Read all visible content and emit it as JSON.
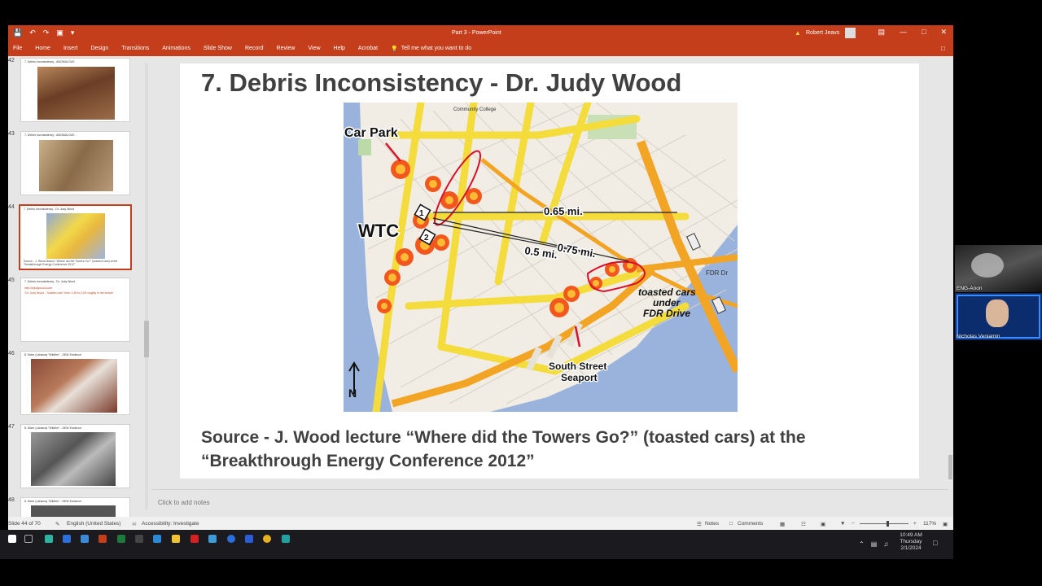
{
  "app": {
    "title": "Part 3  -  PowerPoint",
    "user": "Robert Jeavs",
    "warning_icon": "warning-icon",
    "quick_access": [
      "save-icon",
      "undo-icon",
      "redo-icon",
      "present-icon",
      "more-icon"
    ],
    "window_buttons": [
      "ribbon-display-icon",
      "minimize-icon",
      "maximize-icon",
      "close-icon"
    ]
  },
  "menu": {
    "items": [
      "File",
      "Home",
      "Insert",
      "Design",
      "Transitions",
      "Animations",
      "Slide Show",
      "Record",
      "Review",
      "View",
      "Help",
      "Acrobat"
    ],
    "tell_me": "Tell me what you want to do"
  },
  "sidebar": {
    "slides": [
      {
        "number": "42",
        "title": "7. Debris Inconsistency - ANOMALOUS",
        "type": "image",
        "img_color": "#8a5a3a"
      },
      {
        "number": "43",
        "title": "7. Debris Inconsistency - ANOMALOUS",
        "type": "image",
        "img_color": "#a88a6a"
      },
      {
        "number": "44",
        "title": "7. Debris Inconsistency - Dr. Judy Wood",
        "type": "map",
        "caption": "Source - J. Wood lecture \"Where did the Towers Go?\" (toasted cars) at the \"Breakthrough Energy Conference 2012\"",
        "selected": true
      },
      {
        "number": "45",
        "title": "7. Debris Inconsistency - Dr. Judy Wood",
        "type": "text",
        "lines": [
          "http://drjudywood.com",
          "\"Dr. Judy Wood - Toasted cars\" from 1.35 to 2:05 roughly in the lecture"
        ]
      },
      {
        "number": "46",
        "title": "8. Mixer (Lahaina) \"Wildfire\" - DEW Evidence",
        "type": "image",
        "img_color": "#7a4a3a"
      },
      {
        "number": "47",
        "title": "8. Mixer (Lahaina) \"Wildfire\" - DEW Evidence",
        "type": "image",
        "img_color": "#6a6a6a"
      },
      {
        "number": "48",
        "title": "8. Mixer (Lahaina) \"Wildfire\" - DEW Evidence",
        "type": "image",
        "img_color": "#555555"
      }
    ]
  },
  "slide": {
    "title": "7. Debris Inconsistency - Dr. Judy Wood",
    "source": "Source - J. Wood lecture “Where did the Towers Go?” (toasted cars) at the “Breakthrough Energy Conference 2012”",
    "map": {
      "labels": {
        "car_park": "Car Park",
        "wtc": "WTC",
        "tower1": "1",
        "tower2": "2",
        "d1": "0.65 mi.",
        "d2": "0.75 mi.",
        "d3": "0.5 mi.",
        "toasted": [
          "toasted cars",
          "under",
          "FDR Drive"
        ],
        "seaport": [
          "South Street",
          "Seaport"
        ],
        "north": "N",
        "fdr": "FDR Dr",
        "college": "Community College"
      }
    }
  },
  "notes": {
    "placeholder": "Click to add notes"
  },
  "status": {
    "slide_count": "Slide 44 of 70",
    "language": "English (United States)",
    "accessibility": "Accessibility: Investigate",
    "notes_btn": "Notes",
    "comments_btn": "Comments",
    "zoom": "117%"
  },
  "taskbar": {
    "time": "10:49 AM",
    "day": "Thursday",
    "date": "2/1/2024"
  },
  "video": [
    {
      "name": "ENG-Anon"
    },
    {
      "name": "Nicholas Veniamin"
    }
  ]
}
